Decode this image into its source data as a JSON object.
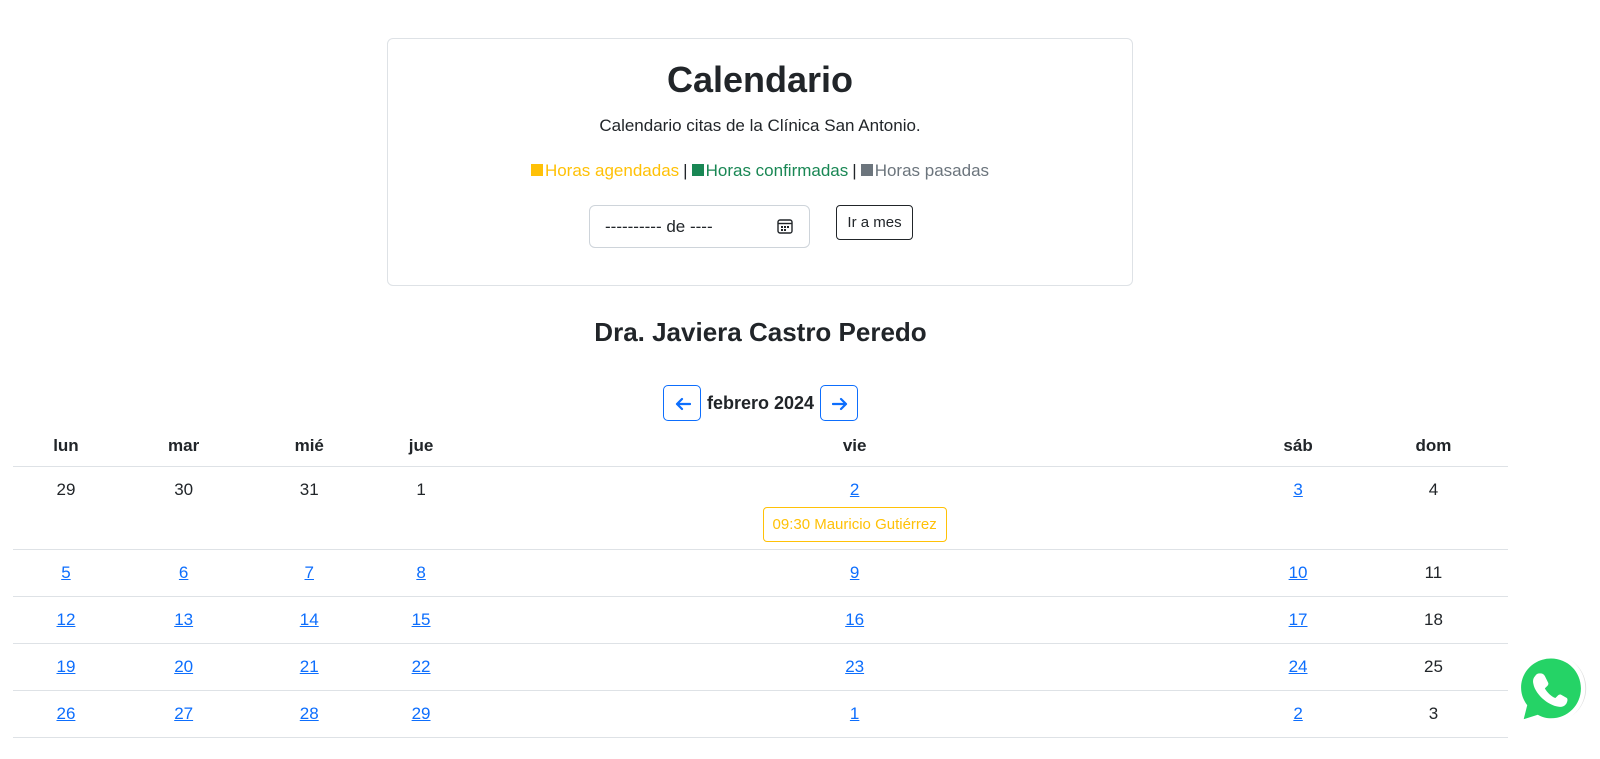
{
  "header": {
    "title": "Calendario",
    "description": "Calendario citas de la Clínica San Antonio.",
    "legend": [
      {
        "label": "Horas agendadas",
        "color": "#ffc107"
      },
      {
        "label": "Horas confirmadas",
        "color": "#198754"
      },
      {
        "label": "Horas pasadas",
        "color": "#6c757d"
      }
    ],
    "separator": "|",
    "month_input_value": "---------- de ----",
    "go_button_label": "Ir a mes"
  },
  "doctor_name": "Dra. Javiera Castro Peredo",
  "nav": {
    "month_label": "febrero 2024",
    "prev_icon": "arrow-left-icon",
    "next_icon": "arrow-right-icon"
  },
  "calendar": {
    "weekdays": [
      "lun",
      "mar",
      "mié",
      "jue",
      "vie",
      "sáb",
      "dom"
    ],
    "weeks": [
      [
        {
          "day": "29",
          "link": false
        },
        {
          "day": "30",
          "link": false
        },
        {
          "day": "31",
          "link": false
        },
        {
          "day": "1",
          "link": false
        },
        {
          "day": "2",
          "link": true,
          "appointment": "09:30 Mauricio Gutiérrez"
        },
        {
          "day": "3",
          "link": true
        },
        {
          "day": "4",
          "link": false
        }
      ],
      [
        {
          "day": "5",
          "link": true
        },
        {
          "day": "6",
          "link": true
        },
        {
          "day": "7",
          "link": true
        },
        {
          "day": "8",
          "link": true
        },
        {
          "day": "9",
          "link": true
        },
        {
          "day": "10",
          "link": true
        },
        {
          "day": "11",
          "link": false
        }
      ],
      [
        {
          "day": "12",
          "link": true
        },
        {
          "day": "13",
          "link": true
        },
        {
          "day": "14",
          "link": true
        },
        {
          "day": "15",
          "link": true
        },
        {
          "day": "16",
          "link": true
        },
        {
          "day": "17",
          "link": true
        },
        {
          "day": "18",
          "link": false
        }
      ],
      [
        {
          "day": "19",
          "link": true
        },
        {
          "day": "20",
          "link": true
        },
        {
          "day": "21",
          "link": true
        },
        {
          "day": "22",
          "link": true
        },
        {
          "day": "23",
          "link": true
        },
        {
          "day": "24",
          "link": true
        },
        {
          "day": "25",
          "link": false
        }
      ],
      [
        {
          "day": "26",
          "link": true
        },
        {
          "day": "27",
          "link": true
        },
        {
          "day": "28",
          "link": true
        },
        {
          "day": "29",
          "link": true
        },
        {
          "day": "1",
          "link": true
        },
        {
          "day": "2",
          "link": true
        },
        {
          "day": "3",
          "link": false
        }
      ]
    ]
  },
  "whatsapp_icon": "whatsapp-icon",
  "colors": {
    "link": "#0d6efd",
    "scheduled": "#ffc107",
    "confirmed": "#198754",
    "past": "#6c757d",
    "whatsapp": "#25d366"
  }
}
